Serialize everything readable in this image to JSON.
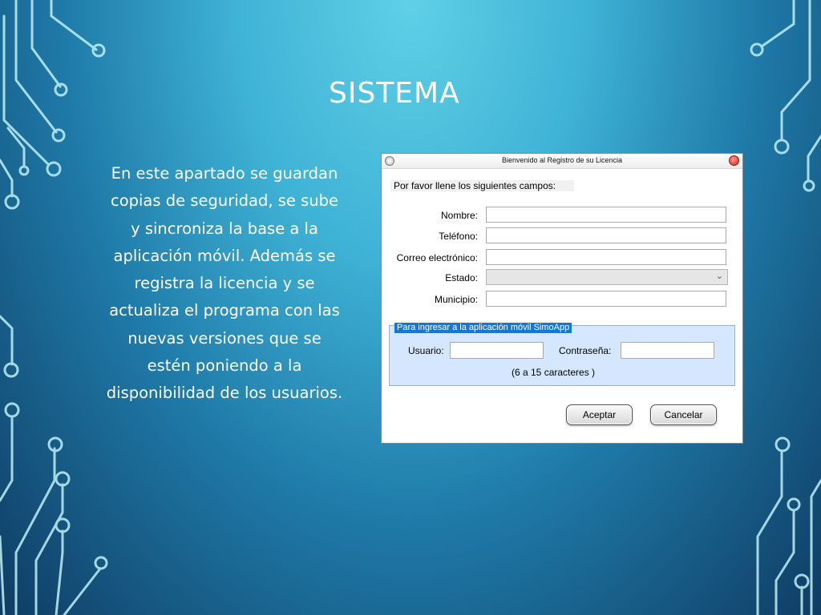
{
  "slide": {
    "title": "SISTEMA",
    "body": "En este apartado se guardan copias de seguridad, se sube y sincroniza la base a la aplicación móvil. Además se registra la licencia y se actualiza el programa con las nuevas versiones que se estén poniendo a la disponibilidad de los usuarios."
  },
  "colors": {
    "background_light": "#5fd0e6",
    "background_dark": "#0f3c63",
    "circuit_line": "#bff0f7",
    "group_background": "#d4e7ff",
    "group_legend": "#1478d8"
  },
  "dialog": {
    "title": "Bienvenido al Registro de su Licencia",
    "header": "Por favor llene los siguientes campos:",
    "fields": {
      "nombre": {
        "label": "Nombre:",
        "value": ""
      },
      "telefono": {
        "label": "Teléfono:",
        "value": ""
      },
      "correo": {
        "label": "Correo electrónico:",
        "value": ""
      },
      "estado": {
        "label": "Estado:",
        "value": ""
      },
      "municipio": {
        "label": "Municipio:",
        "value": ""
      }
    },
    "app_group": {
      "legend": "Para ingresar a la aplicación móvil SimoApp",
      "usuario_label": "Usuario:",
      "usuario_value": "",
      "contrasena_label": "Contraseña:",
      "contrasena_value": "",
      "hint": "(6 a 15 caracteres )"
    },
    "buttons": {
      "accept": "Aceptar",
      "cancel": "Cancelar"
    },
    "icons": {
      "window": "app-icon",
      "close": "close-icon",
      "dropdown": "chevron-down-icon"
    }
  }
}
